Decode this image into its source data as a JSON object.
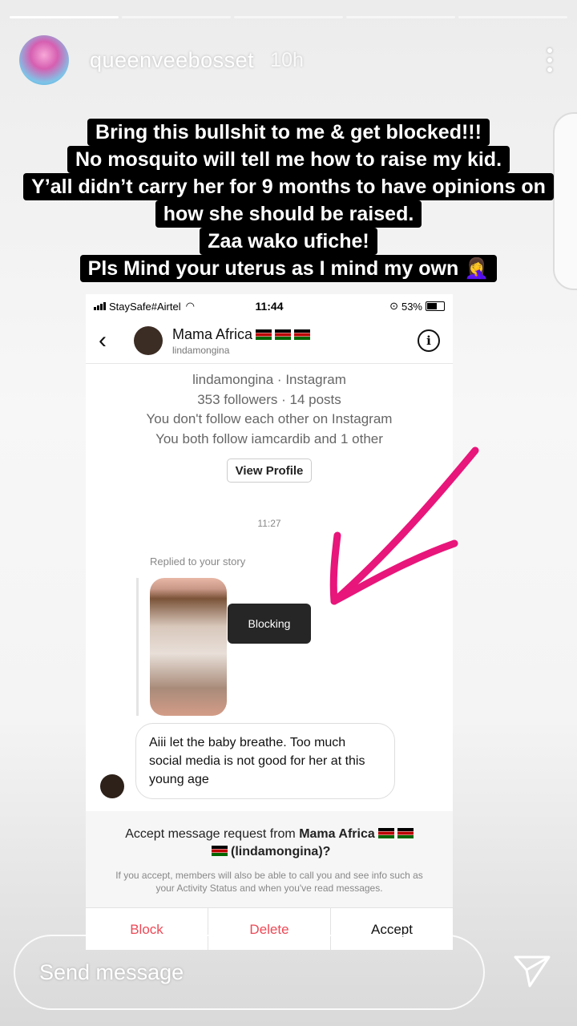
{
  "story": {
    "username": "queenveebosset",
    "time_ago": "10h",
    "caption_lines": [
      "Bring this bullshit to me & get blocked!!!",
      "No mosquito will tell me how to raise my kid.",
      "Y’all didn’t carry her for 9 months to have opinions on",
      "how she should be raised.",
      "Zaa wako ufiche!",
      "Pls Mind your uterus  as I mind my own 🤦‍♀️"
    ],
    "send_placeholder": "Send message"
  },
  "screenshot": {
    "status": {
      "carrier": "StaySafe#Airtel",
      "time": "11:44",
      "battery": "53%"
    },
    "header": {
      "name": "Mama Africa",
      "handle": "lindamongina"
    },
    "profile": {
      "line1": "lindamongina · Instagram",
      "line2": "353 followers · 14 posts",
      "line3": "You don't follow each other on Instagram",
      "line4": "You both follow iamcardib and 1 other",
      "button": "View Profile"
    },
    "chat_time": "11:27",
    "replied_label": "Replied to your story",
    "tooltip": "Blocking",
    "message": "Aiii let the baby breathe.  Too much social media is not good for her at this young age",
    "request": {
      "prefix": "Accept message request from ",
      "name": "Mama Africa",
      "handle": "(lindamongina)?",
      "note": "If you accept, members will also be able to call you and see info such as your Activity Status and when you've read messages."
    },
    "actions": {
      "block": "Block",
      "delete": "Delete",
      "accept": "Accept"
    }
  },
  "colors": {
    "accent_red": "#ed4956",
    "arrow_pink": "#e8157a"
  }
}
